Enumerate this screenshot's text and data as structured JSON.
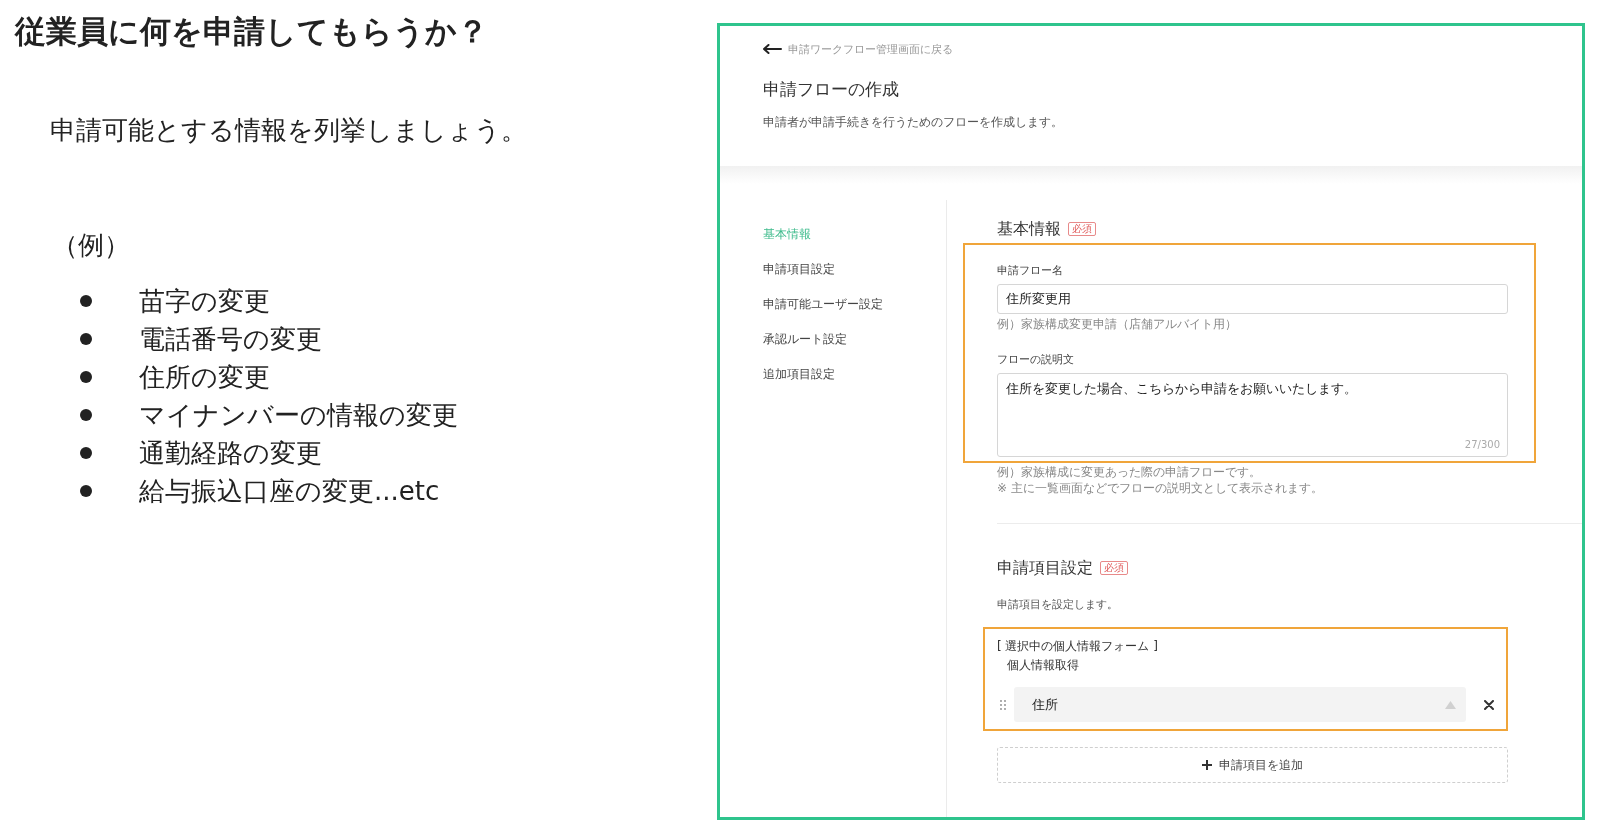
{
  "slide": {
    "title": "従業員に何を申請してもらうか？",
    "lead": "申請可能とする情報を列挙しましょう。",
    "example_label": "（例）",
    "examples": [
      "苗字の変更",
      "電話番号の変更",
      "住所の変更",
      "マイナンバーの情報の変更",
      "通勤経路の変更",
      "給与振込口座の変更...etc"
    ]
  },
  "screenshot": {
    "back_link": "申請ワークフロー管理画面に戻る",
    "title": "申請フローの作成",
    "description": "申請者が申請手続きを行うためのフローを作成します。",
    "nav": [
      {
        "label": "基本情報",
        "selected": true
      },
      {
        "label": "申請項目設定",
        "selected": false
      },
      {
        "label": "申請可能ユーザー設定",
        "selected": false
      },
      {
        "label": "承認ルート設定",
        "selected": false
      },
      {
        "label": "追加項目設定",
        "selected": false
      }
    ],
    "basic_info": {
      "heading": "基本情報",
      "badge": "必須",
      "highlighted": true,
      "fields": [
        {
          "kind": "text",
          "label": "申請フロー名",
          "value": "住所変更用",
          "hint": "例）家族構成変更申請（店舗アルバイト用）"
        },
        {
          "kind": "textarea",
          "label": "フローの説明文",
          "value": "住所を変更した場合、こちらから申請をお願いいたします。",
          "counter": "27/300"
        }
      ],
      "notes": [
        "例）家族構成に変更あった際の申請フローです。",
        "※ 主に一覧画面などでフローの説明文として表示されます。"
      ]
    },
    "application_items": {
      "heading": "申請項目設定",
      "badge": "必須",
      "description": "申請項目を設定します。",
      "highlighted": true,
      "form_label": "[ 選択中の個人情報フォーム ]",
      "form_name": "個人情報取得",
      "items": [
        {
          "value": "住所"
        }
      ],
      "add_button": "申請項目を追加"
    }
  }
}
